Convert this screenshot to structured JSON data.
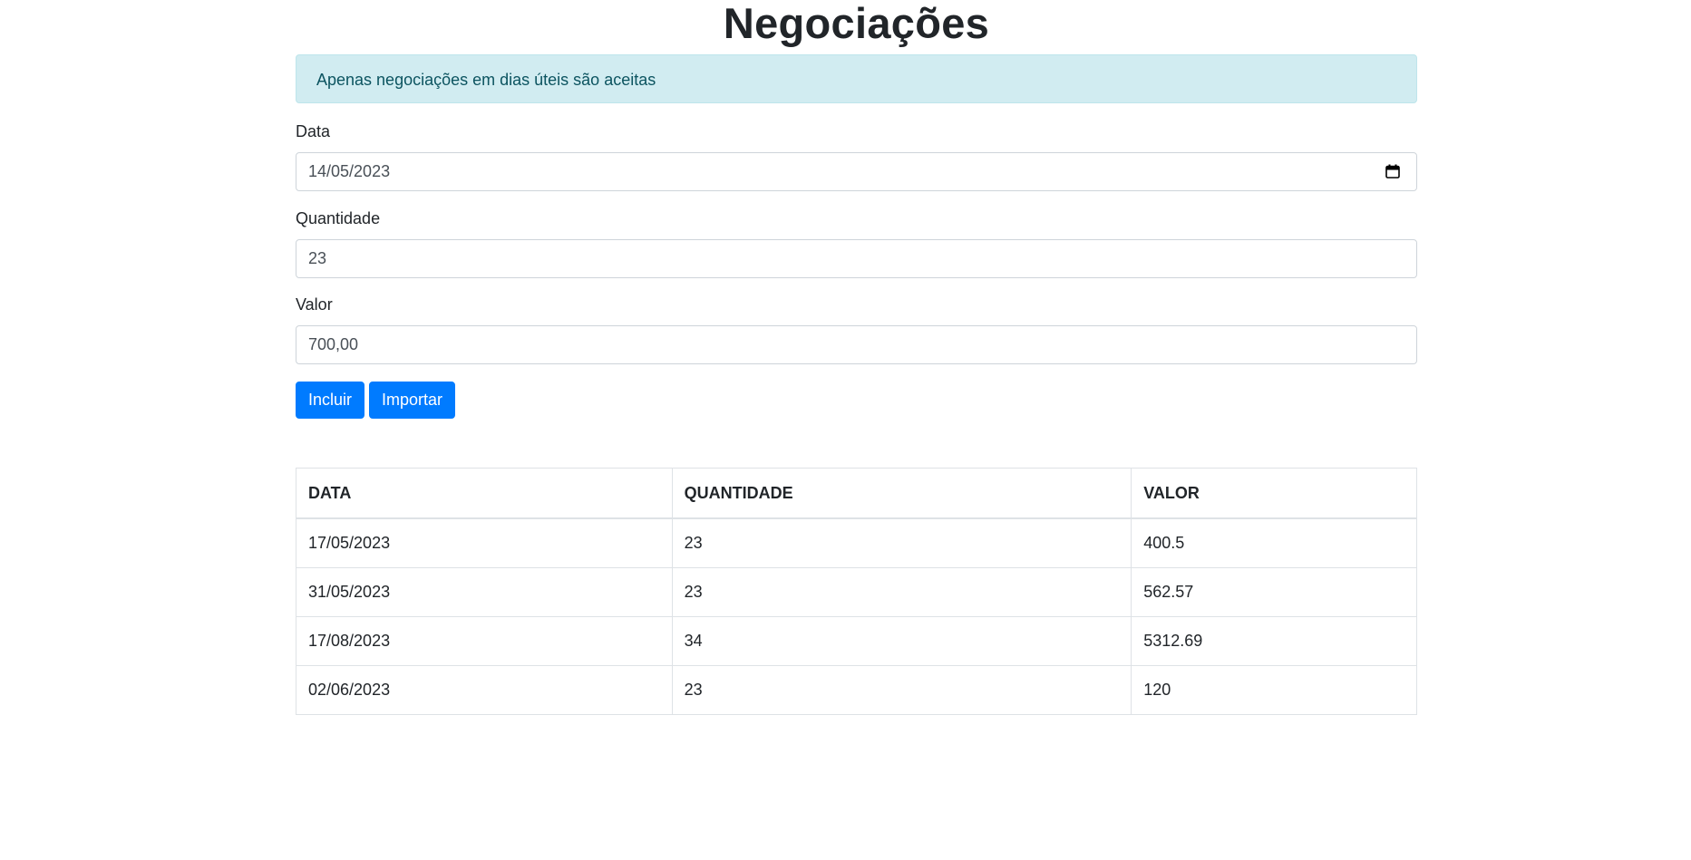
{
  "page": {
    "title": "Negociações"
  },
  "alert": {
    "message": "Apenas negociações em dias úteis são aceitas"
  },
  "form": {
    "date": {
      "label": "Data",
      "value": "14/05/2023"
    },
    "quantity": {
      "label": "Quantidade",
      "value": "23"
    },
    "value": {
      "label": "Valor",
      "value": "700,00"
    },
    "buttons": {
      "include": "Incluir",
      "import": "Importar"
    }
  },
  "table": {
    "headers": [
      "DATA",
      "QUANTIDADE",
      "VALOR"
    ],
    "rows": [
      [
        "17/05/2023",
        "23",
        "400.5"
      ],
      [
        "31/05/2023",
        "23",
        "562.57"
      ],
      [
        "17/08/2023",
        "34",
        "5312.69"
      ],
      [
        "02/06/2023",
        "23",
        "120"
      ]
    ]
  },
  "icons": {
    "calendar": "calendar-icon"
  },
  "colors": {
    "primary": "#007bff",
    "alert_bg": "#d1ecf1",
    "alert_text": "#0c5460"
  }
}
